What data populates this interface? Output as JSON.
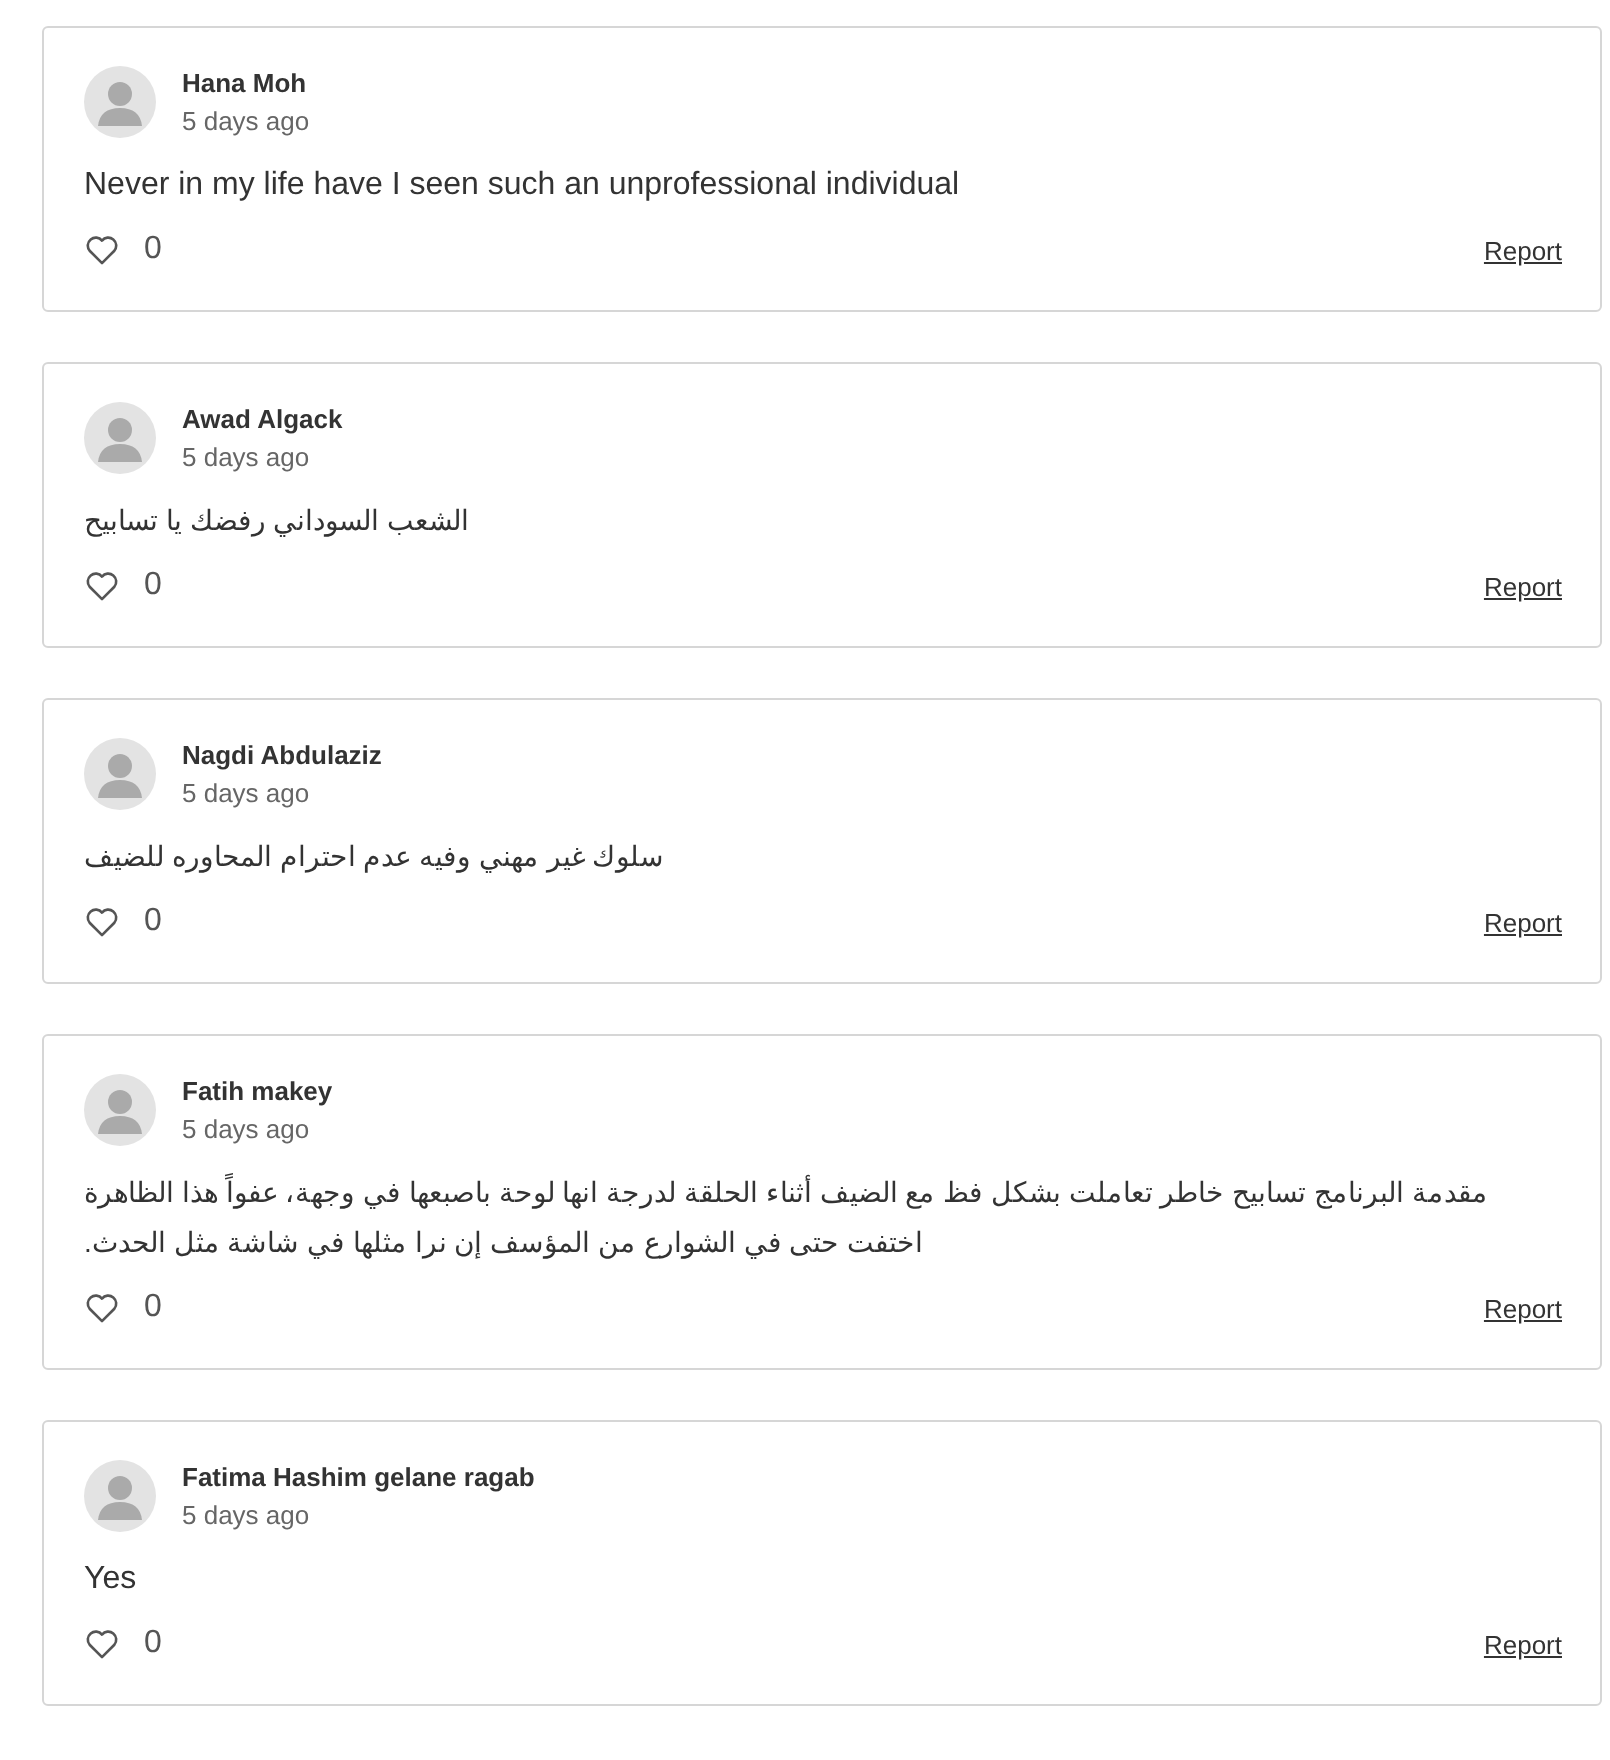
{
  "comments": [
    {
      "author": "Hana Moh",
      "time": "5 days ago",
      "text": "Never in my life have I seen such an unprofessional individual",
      "likes": "0",
      "report": "Report"
    },
    {
      "author": "Awad Algack",
      "time": "5 days ago",
      "text": "الشعب السوداني رفضك يا تسابيح",
      "likes": "0",
      "report": "Report"
    },
    {
      "author": "Nagdi Abdulaziz",
      "time": "5 days ago",
      "text": "سلوك غير مهني وفيه عدم احترام المحاوره للضيف",
      "likes": "0",
      "report": "Report"
    },
    {
      "author": "Fatih makey",
      "time": "5 days ago",
      "text": "مقدمة البرنامج تسابيح خاطر تعاملت بشكل فظ مع الضيف أثناء الحلقة لدرجة انها لوحة باصبعها في وجهة، عفواً هذا الظاهرة اختفت حتى في الشوارع من المؤسف إن نرا مثلها في شاشة مثل الحدث.",
      "likes": "0",
      "report": "Report"
    },
    {
      "author": "Fatima Hashim gelane ragab",
      "time": "5 days ago",
      "text": "Yes",
      "likes": "0",
      "report": "Report"
    }
  ]
}
